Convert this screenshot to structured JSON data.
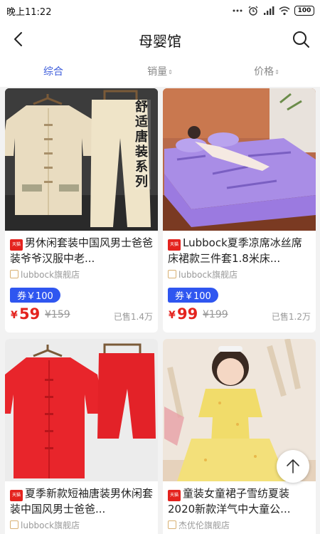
{
  "status_bar": {
    "time": "晚上11:22",
    "battery": "100",
    "icons": [
      "dots-icon",
      "alarm-icon",
      "signal-icon",
      "wifi-icon",
      "battery-icon"
    ]
  },
  "nav": {
    "title": "母婴馆",
    "back_icon": "back-arrow-icon",
    "search_icon": "search-icon"
  },
  "tabs": [
    {
      "label": "综合",
      "active": true
    },
    {
      "label": "销量",
      "active": false,
      "sort_icon": "⇕"
    },
    {
      "label": "价格",
      "active": false,
      "sort_icon": "⇕"
    }
  ],
  "badge_text": "天猫",
  "currency": "¥",
  "products": [
    {
      "title": "男休闲套装中国风男士爸爸装爷爷汉服中老...",
      "shop": "lubbock旗舰店",
      "coupon": "券￥100",
      "price": "59",
      "old_price": "¥159",
      "sold": "已售1.4万",
      "image_text": "舒适唐装系列"
    },
    {
      "title": "Lubbock夏季凉席冰丝席床裙款三件套1.8米床...",
      "shop": "lubbock旗舰店",
      "coupon": "券￥100",
      "price": "99",
      "old_price": "¥199",
      "sold": "已售1.2万"
    },
    {
      "title": "夏季新款短袖唐装男休闲套装中国风男士爸爸...",
      "shop": "lubbock旗舰店"
    },
    {
      "title": "童装女童裙子雪纺夏装2020新款洋气中大童公...",
      "shop": "杰优伦旗舰店"
    }
  ],
  "colors": {
    "accent": "#3b5bdb",
    "price": "#e4231e",
    "coupon": "#2f56f0",
    "badge": "#e4231e"
  }
}
